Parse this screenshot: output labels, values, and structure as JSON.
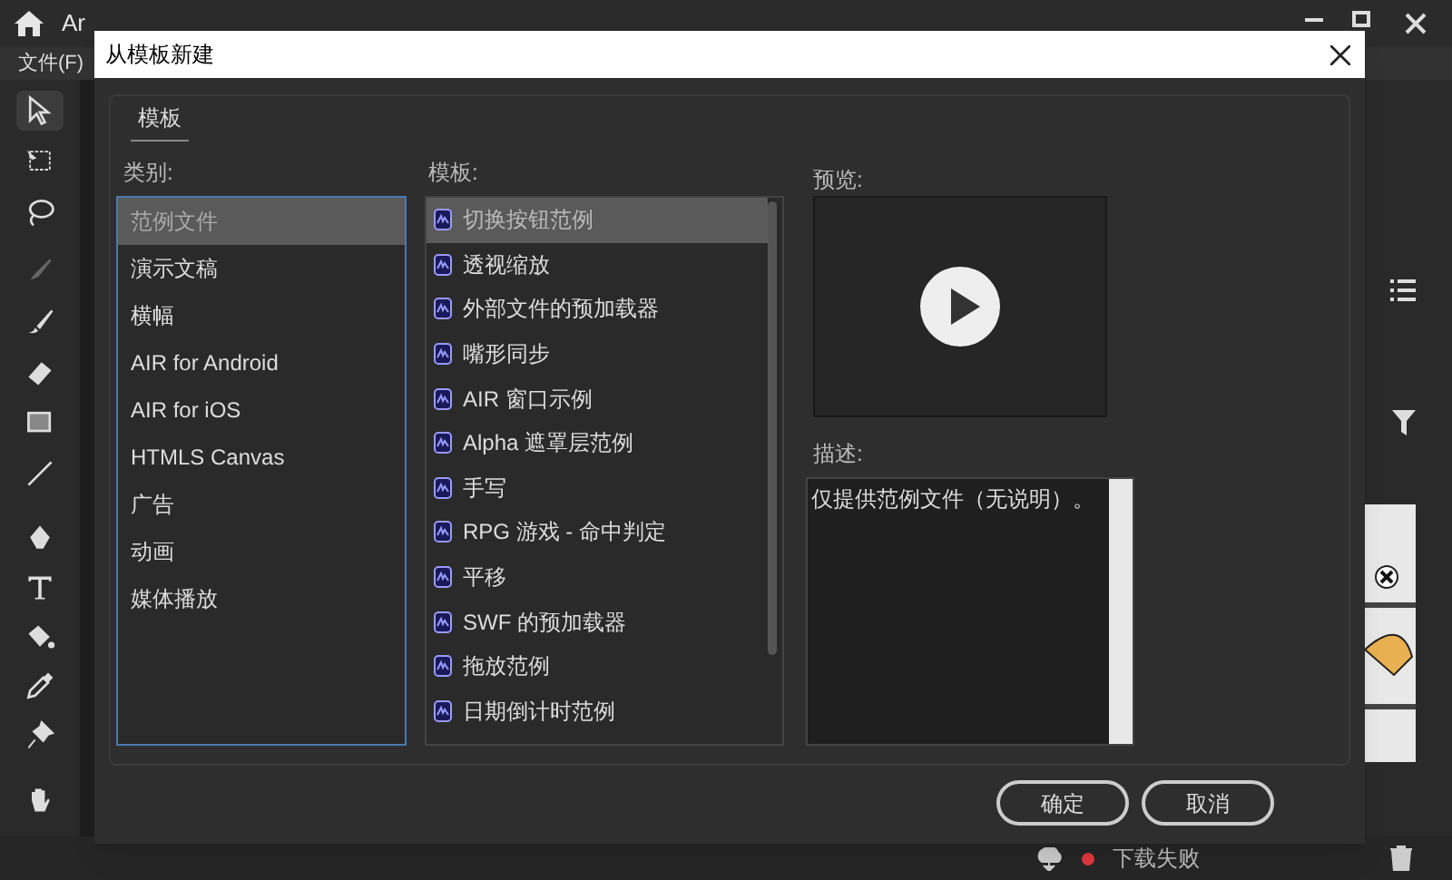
{
  "app": {
    "tab_label": "Ar",
    "menu": [
      "文件(F)"
    ],
    "status": {
      "text": "下载失败",
      "color": "#e0383e"
    }
  },
  "dialog": {
    "title": "从模板新建",
    "tabs": [
      {
        "label": "模板",
        "selected": true
      }
    ],
    "category_label": "类别:",
    "categories": [
      {
        "label": "范例文件",
        "selected": true
      },
      {
        "label": "演示文稿",
        "selected": false
      },
      {
        "label": "横幅",
        "selected": false
      },
      {
        "label": "AIR for Android",
        "selected": false
      },
      {
        "label": "AIR for iOS",
        "selected": false
      },
      {
        "label": "HTMLS Canvas",
        "selected": false
      },
      {
        "label": "广告",
        "selected": false
      },
      {
        "label": "动画",
        "selected": false
      },
      {
        "label": "媒体播放",
        "selected": false
      }
    ],
    "template_label": "模板:",
    "templates": [
      {
        "label": "切换按钮范例",
        "selected": true
      },
      {
        "label": "透视缩放",
        "selected": false
      },
      {
        "label": "外部文件的预加载器",
        "selected": false
      },
      {
        "label": "嘴形同步",
        "selected": false
      },
      {
        "label": "AIR 窗口示例",
        "selected": false
      },
      {
        "label": "Alpha 遮罩层范例",
        "selected": false
      },
      {
        "label": "手写",
        "selected": false
      },
      {
        "label": "RPG 游戏 - 命中判定",
        "selected": false
      },
      {
        "label": "平移",
        "selected": false
      },
      {
        "label": "SWF 的预加载器",
        "selected": false
      },
      {
        "label": "拖放范例",
        "selected": false
      },
      {
        "label": "日期倒计时范例",
        "selected": false
      }
    ],
    "preview_label": "预览:",
    "description_label": "描述:",
    "description": "仅提供范例文件（无说明）。",
    "buttons": [
      "确定",
      "取消"
    ]
  }
}
